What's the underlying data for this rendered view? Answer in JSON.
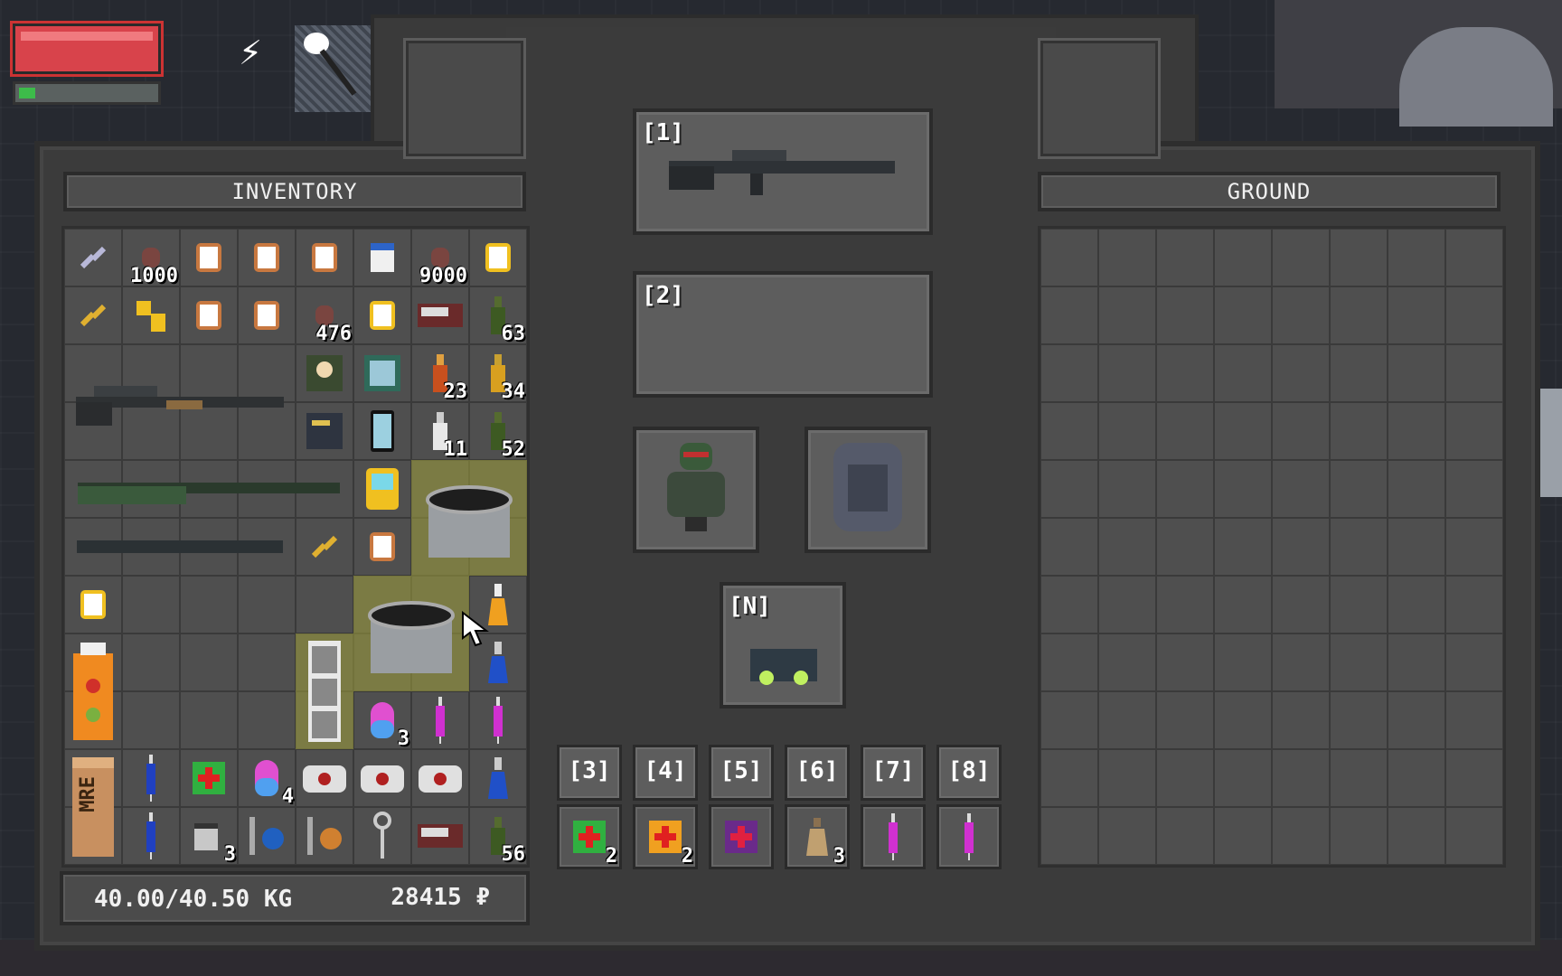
{
  "hud": {
    "health": 1.0,
    "stamina": 0.12,
    "energy_icon": "lightning-bolt-icon",
    "melee_icon": "shovel-icon"
  },
  "inventory": {
    "title": "INVENTORY",
    "weight": "40.00/40.50 KG",
    "money": "28415",
    "currency": "₽",
    "quantities": {
      "a": "1000",
      "b": "9000",
      "c": "476",
      "d": "63",
      "e": "23",
      "f": "34",
      "g": "11",
      "h": "52",
      "i": "3",
      "j": "4",
      "k": "3",
      "l": "56"
    },
    "mre_label": "MRE"
  },
  "ground": {
    "title": "GROUND"
  },
  "equipment": {
    "primary_label": "[1]",
    "secondary_label": "[2]",
    "nv_label": "[N]"
  },
  "hotbar": {
    "labels": [
      "[3]",
      "[4]",
      "[5]",
      "[6]",
      "[7]",
      "[8]"
    ],
    "qty": [
      "2",
      "2",
      "",
      "3",
      "",
      ""
    ]
  },
  "colors": {
    "panel": "#3b3b3b",
    "slot": "#4f4f4f",
    "health": "#d8434b",
    "stamina": "#3dbb4a",
    "highlight": "#a0a03c"
  }
}
